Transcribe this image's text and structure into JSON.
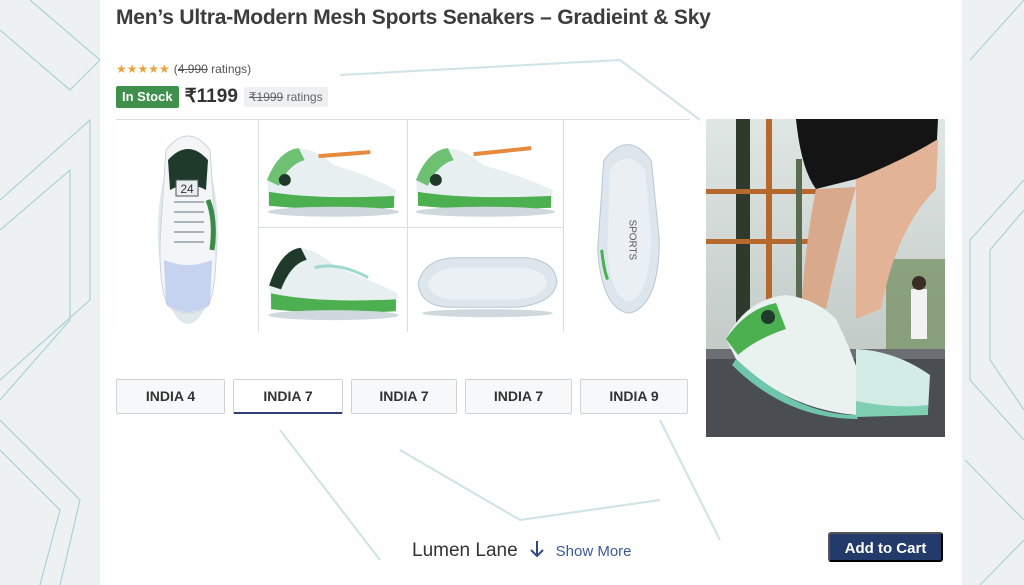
{
  "product": {
    "title": "Men’s Ultra-Modern Mesh Sports Senakers – Gradieint & Sky",
    "stars": "★★★★★",
    "rating_count": "4.990",
    "rating_suffix": " ratings)",
    "rating_prefix": "(",
    "stock": "In Stock",
    "price": "₹1199",
    "mrp": "₹1999",
    "mrp_suffix": " ratings"
  },
  "gallery": {
    "images": [
      {
        "icon": "shoe-top-view",
        "label": "24"
      },
      {
        "icon": "shoe-side-view"
      },
      {
        "icon": "shoe-side-view-tag"
      },
      {
        "icon": "shoe-sole-view",
        "label": "SPORTS"
      },
      {
        "icon": "shoe-side-view-alt"
      },
      {
        "icon": "shoe-sole-side-view"
      }
    ]
  },
  "sizes": [
    {
      "label": "INDIA 4",
      "selected": false
    },
    {
      "label": "INDIA 7",
      "selected": true
    },
    {
      "label": "INDIA 7",
      "selected": false
    },
    {
      "label": "INDIA 7",
      "selected": false
    },
    {
      "label": "INDIA 9",
      "selected": false
    }
  ],
  "footer": {
    "brand": "Lumen Lane",
    "show_more": "Show More",
    "add_to_cart": "Add to Cart"
  },
  "colors": {
    "accent": "#233a6b",
    "stock_green": "#3f8f4d",
    "star": "#e8a33a",
    "shoe_green": "#4caf50",
    "shoe_teal": "#9fd8cf"
  }
}
